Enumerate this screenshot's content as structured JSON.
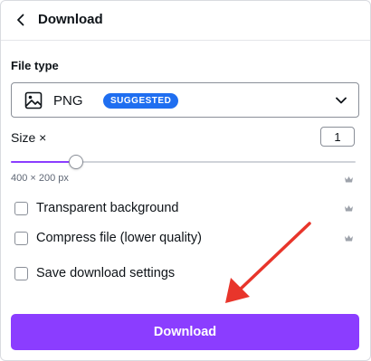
{
  "header": {
    "title": "Download",
    "back_icon": "chevron-left-icon"
  },
  "file_type": {
    "label": "File type",
    "selected": "PNG",
    "badge": "SUGGESTED",
    "icon": "image-icon",
    "dropdown_icon": "chevron-down-icon"
  },
  "size": {
    "label": "Size ×",
    "multiplier": "1",
    "dimensions": "400 × 200 px",
    "slider_fraction": 0.19
  },
  "options": [
    {
      "label": "Transparent background",
      "checked": false,
      "premium": true
    },
    {
      "label": "Compress file (lower quality)",
      "checked": false,
      "premium": true
    },
    {
      "label": "Save download settings",
      "checked": false,
      "premium": false
    }
  ],
  "download_button": {
    "label": "Download"
  },
  "colors": {
    "accent": "#8b3dff",
    "badge": "#1f6ef0",
    "annotation_arrow": "#e8352b",
    "premium_crown": "#9ea3ab"
  }
}
